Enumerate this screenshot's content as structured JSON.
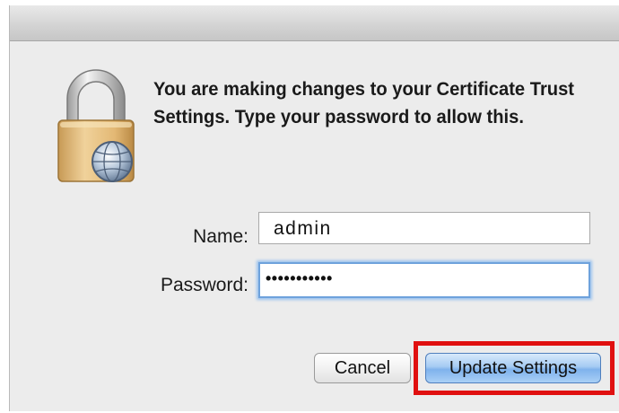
{
  "dialog": {
    "message": "You are making changes to your Certificate Trust Settings. Type your password to allow this.",
    "icon": "lock-icon"
  },
  "form": {
    "name_label": "Name:",
    "name_value": "admin",
    "password_label": "Password:",
    "password_value": "•••••••••••"
  },
  "buttons": {
    "cancel_label": "Cancel",
    "update_label": "Update Settings"
  },
  "colors": {
    "highlight": "#e01010",
    "focus_ring": "#6ea2dc",
    "default_button": "#7fb2ec"
  }
}
